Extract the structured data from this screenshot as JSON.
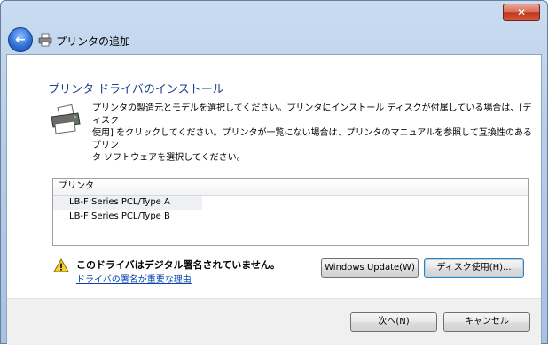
{
  "window": {
    "close_label": "✕"
  },
  "navbar": {
    "back_glyph": "←",
    "title": "プリンタの追加"
  },
  "main": {
    "heading": "プリンタ ドライバのインストール",
    "description_lines": [
      "プリンタの製造元とモデルを選択してください。プリンタにインストール ディスクが付属している場合は、[ディスク",
      "使用] をクリックしてください。プリンタが一覧にない場合は、プリンタのマニュアルを参照して互換性のあるプリン",
      "タ ソフトウェアを選択してください。"
    ],
    "list": {
      "header": "プリンタ",
      "items": [
        "LB-F Series PCL/Type A",
        "LB-F Series PCL/Type B"
      ]
    },
    "warning": {
      "title": "このドライバはデジタル署名されていません。",
      "link": "ドライバの署名が重要な理由"
    },
    "buttons": {
      "windows_update": "Windows Update(W)",
      "have_disk": "ディスク使用(H)..."
    }
  },
  "footer": {
    "next": "次へ(N)",
    "cancel": "キャンセル"
  },
  "icons": {
    "close": "close-icon",
    "back": "back-arrow-icon",
    "printer": "printer-icon",
    "warning": "warning-icon"
  },
  "colors": {
    "heading": "#1e3f8a",
    "link": "#0645ad",
    "close_button": "#c2381f",
    "back_button": "#2f6fd6"
  }
}
